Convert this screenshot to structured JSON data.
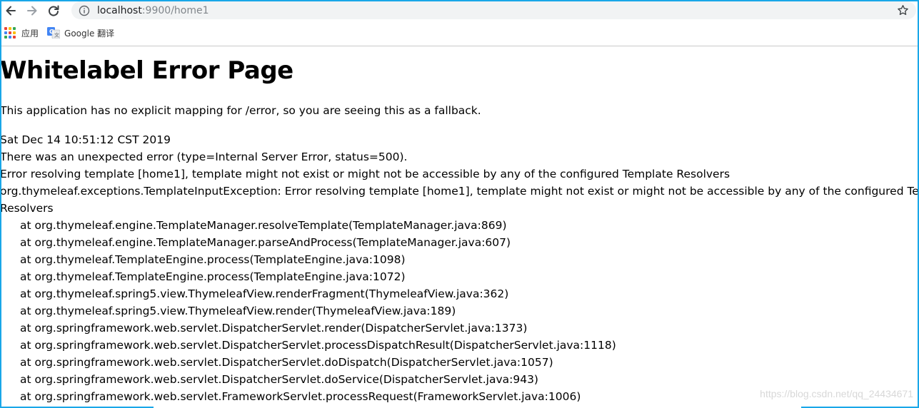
{
  "browser": {
    "url_host": "localhost",
    "url_rest": ":9900/home1",
    "bookmarks": [
      {
        "label": "应用",
        "icon": "apps-grid-icon"
      },
      {
        "label": "Google 翻译",
        "icon": "google-translate-icon"
      }
    ]
  },
  "page": {
    "title": "Whitelabel Error Page",
    "fallback": "This application has no explicit mapping for /error, so you are seeing this as a fallback.",
    "timestamp": "Sat Dec 14 10:51:12 CST 2019",
    "error_type": "There was an unexpected error (type=Internal Server Error, status=500).",
    "message": "Error resolving template [home1], template might not exist or might not be accessible by any of the configured Template Resolvers",
    "exception_line1": "org.thymeleaf.exceptions.TemplateInputException: Error resolving template [home1], template might not exist or might not be accessible by any of the configured Template",
    "exception_line2": "Resolvers",
    "stack": [
      "at org.thymeleaf.engine.TemplateManager.resolveTemplate(TemplateManager.java:869)",
      "at org.thymeleaf.engine.TemplateManager.parseAndProcess(TemplateManager.java:607)",
      "at org.thymeleaf.TemplateEngine.process(TemplateEngine.java:1098)",
      "at org.thymeleaf.TemplateEngine.process(TemplateEngine.java:1072)",
      "at org.thymeleaf.spring5.view.ThymeleafView.renderFragment(ThymeleafView.java:362)",
      "at org.thymeleaf.spring5.view.ThymeleafView.render(ThymeleafView.java:189)",
      "at org.springframework.web.servlet.DispatcherServlet.render(DispatcherServlet.java:1373)",
      "at org.springframework.web.servlet.DispatcherServlet.processDispatchResult(DispatcherServlet.java:1118)",
      "at org.springframework.web.servlet.DispatcherServlet.doDispatch(DispatcherServlet.java:1057)",
      "at org.springframework.web.servlet.DispatcherServlet.doService(DispatcherServlet.java:943)",
      "at org.springframework.web.servlet.FrameworkServlet.processRequest(FrameworkServlet.java:1006)"
    ]
  },
  "watermark": "https://blog.csdn.net/qq_24434671",
  "colors": {
    "frame": "#19a7e8",
    "omnibox": "#f1f3f4",
    "url_muted": "#80868b"
  }
}
